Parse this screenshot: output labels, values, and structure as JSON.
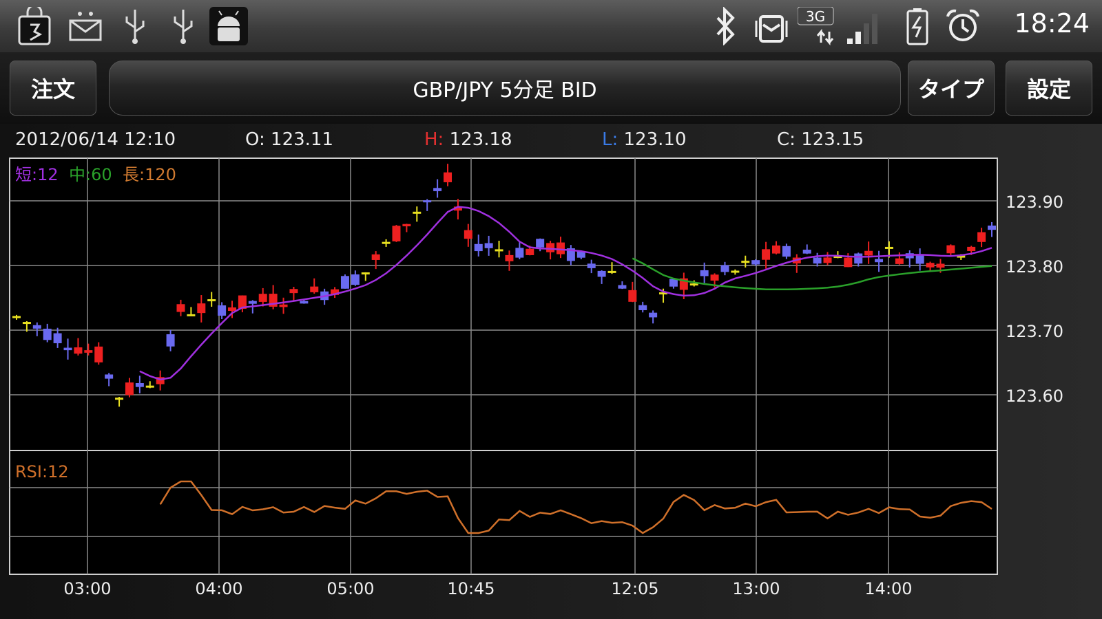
{
  "status_bar": {
    "time": "18:24",
    "network": "3G",
    "left_icons": [
      "shopping-bag-icon",
      "mail-icon",
      "usb-icon",
      "usb-icon",
      "android-debug-icon"
    ],
    "right_icons": [
      "bluetooth-icon",
      "vibrate-icon",
      "network-3g-icon",
      "signal-icon",
      "battery-charging-icon",
      "alarm-icon"
    ]
  },
  "action_bar": {
    "order_label": "注文",
    "title": "GBP/JPY 5分足 BID",
    "type_label": "タイプ",
    "settings_label": "設定"
  },
  "ohlc": {
    "datetime": "2012/06/14 12:10",
    "open_key": "O:",
    "open": "123.11",
    "high_key": "H:",
    "high": "123.18",
    "low_key": "L:",
    "low": "123.10",
    "close_key": "C:",
    "close": "123.15"
  },
  "chart": {
    "legend": {
      "short": "短:12",
      "mid": "中:60",
      "long": "長:120",
      "short_color": "#a030e0",
      "mid_color": "#2aa02a",
      "long_color": "#d07a30"
    },
    "y_ticks": [
      "123.90",
      "123.80",
      "123.70",
      "123.60"
    ],
    "x_ticks": [
      "03:00",
      "04:00",
      "05:00",
      "10:45",
      "12:05",
      "13:00",
      "14:00"
    ],
    "rsi_label": "RSI:12",
    "rsi_color": "#d0702a",
    "up_color": "#ee2020",
    "down_color": "#6a6af0",
    "doji_color": "#e8e020",
    "grid_color": "#8a8a8a"
  }
}
